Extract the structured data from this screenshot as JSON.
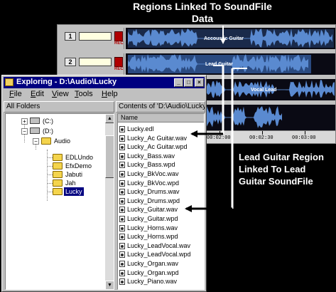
{
  "callouts": {
    "top": "Regions Linked To SoundFile Data",
    "right": "Lead Guitar Region Linked To Lead Guitar SoundFile"
  },
  "editor": {
    "tracks": [
      {
        "number": "1",
        "field": "",
        "rec_label": "REC",
        "region_label": "Accoustic Guitar"
      },
      {
        "number": "2",
        "field": "",
        "rec_label": "REC",
        "region_label": "Lead Guitar"
      },
      {
        "number": "",
        "field": "",
        "rec_label": "",
        "region_label": "Vocal Lead"
      },
      {
        "number": "",
        "field": "",
        "rec_label": "",
        "region_label": ""
      }
    ],
    "ruler_ticks": [
      "00:02:00",
      "00:02:30",
      "00:03:00"
    ]
  },
  "explorer": {
    "title": "Exploring - D:\\Audio\\Lucky",
    "buttons": {
      "minimize": "_",
      "maximize": "□",
      "close": "×"
    },
    "menu": [
      {
        "u": "F",
        "rest": "ile"
      },
      {
        "u": "E",
        "rest": "dit"
      },
      {
        "u": "V",
        "rest": "iew"
      },
      {
        "u": "T",
        "rest": "ools"
      },
      {
        "u": "H",
        "rest": "elp"
      }
    ],
    "left_header": "All Folders",
    "right_header": "Contents of 'D:\\Audio\\Lucky'",
    "tree": {
      "c_drive": "(C:)",
      "d_drive": "(D:)",
      "audio": "Audio",
      "folders": [
        "EDLUndo",
        "EfxDemo",
        "Jabuti",
        "Jah",
        "Lucky"
      ],
      "selected": "Lucky"
    },
    "column_name": "Name",
    "files": [
      "Lucky.edl",
      "Lucky_Ac Guitar.wav",
      "Lucky_Ac Guitar.wpd",
      "Lucky_Bass.wav",
      "Lucky_Bass.wpd",
      "Lucky_BkVoc.wav",
      "Lucky_BkVoc.wpd",
      "Lucky_Drums.wav",
      "Lucky_Drums.wpd",
      "Lucky_Guitar.wav",
      "Lucky_Guitar.wpd",
      "Lucky_Horns.wav",
      "Lucky_Horns.wpd",
      "Lucky_LeadVocal.wav",
      "Lucky_LeadVocal.wpd",
      "Lucky_Organ.wav",
      "Lucky_Organ.wpd",
      "Lucky_Piano.wav"
    ]
  },
  "colors": {
    "title_bar": "#000080",
    "waveform": "#5a8ad0",
    "lane_bg": "#0a0a14",
    "callout_text": "#ffffff"
  }
}
